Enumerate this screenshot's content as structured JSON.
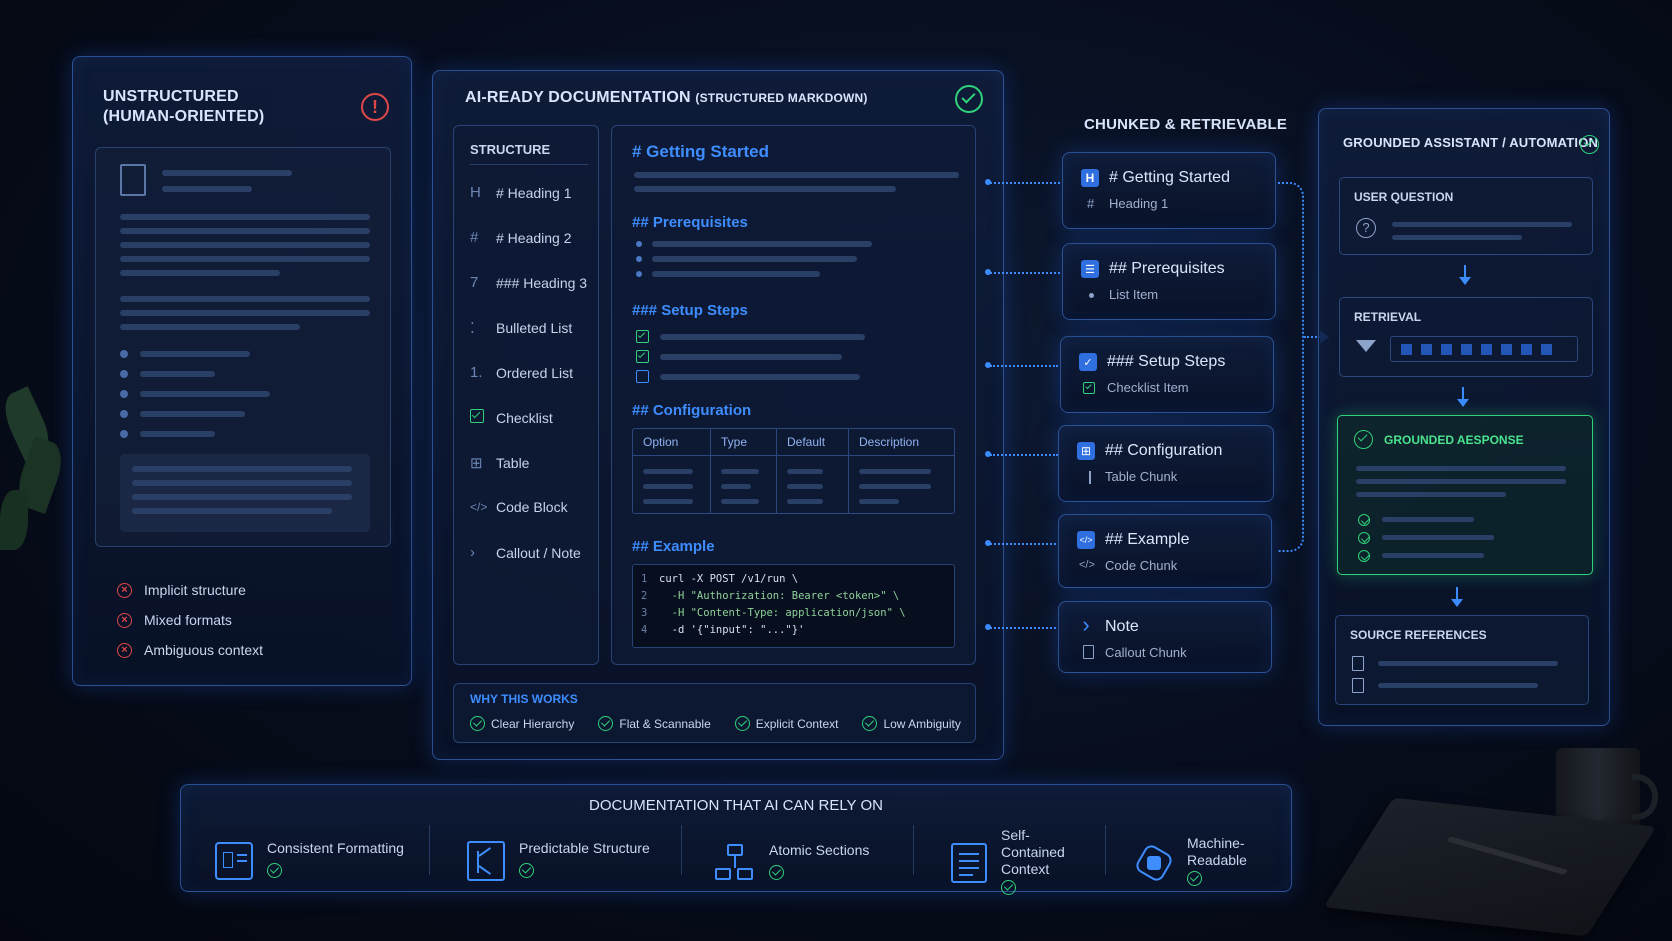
{
  "unstructured": {
    "title_line1": "UNSTRUCTURED",
    "title_line2": "(HUMAN-ORIENTED)",
    "issues": [
      "Implicit structure",
      "Mixed formats",
      "Ambiguous context"
    ]
  },
  "ai_ready": {
    "title": "AI-READY DOCUMENTATION",
    "title_suffix": "(STRUCTURED MARKDOWN)",
    "structure_header": "STRUCTURE",
    "structure_items": [
      {
        "icon": "H",
        "label": "# Heading 1"
      },
      {
        "icon": "#",
        "label": "# Heading 2"
      },
      {
        "icon": "7",
        "label": "### Heading 3"
      },
      {
        "icon": "⁚",
        "label": "Bulleted List"
      },
      {
        "icon": "1.",
        "label": "Ordered List"
      },
      {
        "icon": "checklist-icon",
        "label": "Checklist"
      },
      {
        "icon": "table-icon",
        "label": "Table"
      },
      {
        "icon": "</>",
        "label": "Code Block"
      },
      {
        "icon": ">",
        "label": "Callout / Note"
      }
    ],
    "doc": {
      "h1": "# Getting Started",
      "h_prereq": "## Prerequisites",
      "h_setup": "### Setup Steps",
      "h_config": "## Configuration",
      "table_headers": [
        "Option",
        "Type",
        "Default",
        "Description"
      ],
      "h_example": "## Example",
      "code_lines": [
        {
          "n": "1",
          "text": "curl -X POST /v1/run \\"
        },
        {
          "n": "2",
          "text": "  -H \"Authorization: Bearer <token>\" \\"
        },
        {
          "n": "3",
          "text": "  -H \"Content-Type: application/json\" \\"
        },
        {
          "n": "4",
          "text": "  -d '{\"input\": \"...\"}'"
        }
      ]
    },
    "why_header": "WHY THIS WORKS",
    "why_items": [
      "Clear Hierarchy",
      "Flat & Scannable",
      "Explicit Context",
      "Low Ambiguity"
    ]
  },
  "chunks": {
    "header": "CHUNKED & RETRIEVABLE",
    "items": [
      {
        "title": "# Getting Started",
        "sub": "Heading 1",
        "icon": "H",
        "sub_icon": "#"
      },
      {
        "title": "## Prerequisites",
        "sub": "List Item",
        "icon": "list-icon",
        "sub_icon": "•"
      },
      {
        "title": "### Setup Steps",
        "sub": "Checklist Item",
        "icon": "checklist-icon",
        "sub_icon": "check-icon"
      },
      {
        "title": "## Configuration",
        "sub": "Table Chunk",
        "icon": "table-icon",
        "sub_icon": "|"
      },
      {
        "title": "## Example",
        "sub": "Code Chunk",
        "icon": "code-icon",
        "sub_icon": "</>"
      },
      {
        "title": "Note",
        "sub": "Callout Chunk",
        "icon": "chevron-right-icon",
        "sub_icon": "doc-icon"
      }
    ]
  },
  "assistant": {
    "header": "GROUNDED ASSISTANT / AUTOMATION",
    "user_question": "USER QUESTION",
    "retrieval": "RETRIEVAL",
    "grounded_response": "GROUNDED AESPONSE",
    "source_refs": "SOURCE REFERENCES"
  },
  "footer": {
    "title": "DOCUMENTATION THAT AI CAN RELY ON",
    "features": [
      {
        "label": "Consistent Formatting",
        "icon": "formatting-icon"
      },
      {
        "label": "Predictable Structure",
        "icon": "structure-icon"
      },
      {
        "label": "Atomic Sections",
        "icon": "sections-icon"
      },
      {
        "label": "Self-Contained Context",
        "icon": "context-icon"
      },
      {
        "label": "Machine-Readable",
        "icon": "machine-icon"
      }
    ]
  },
  "colors": {
    "accent": "#3d8dff",
    "success": "#2fd17a",
    "error": "#e04848"
  }
}
